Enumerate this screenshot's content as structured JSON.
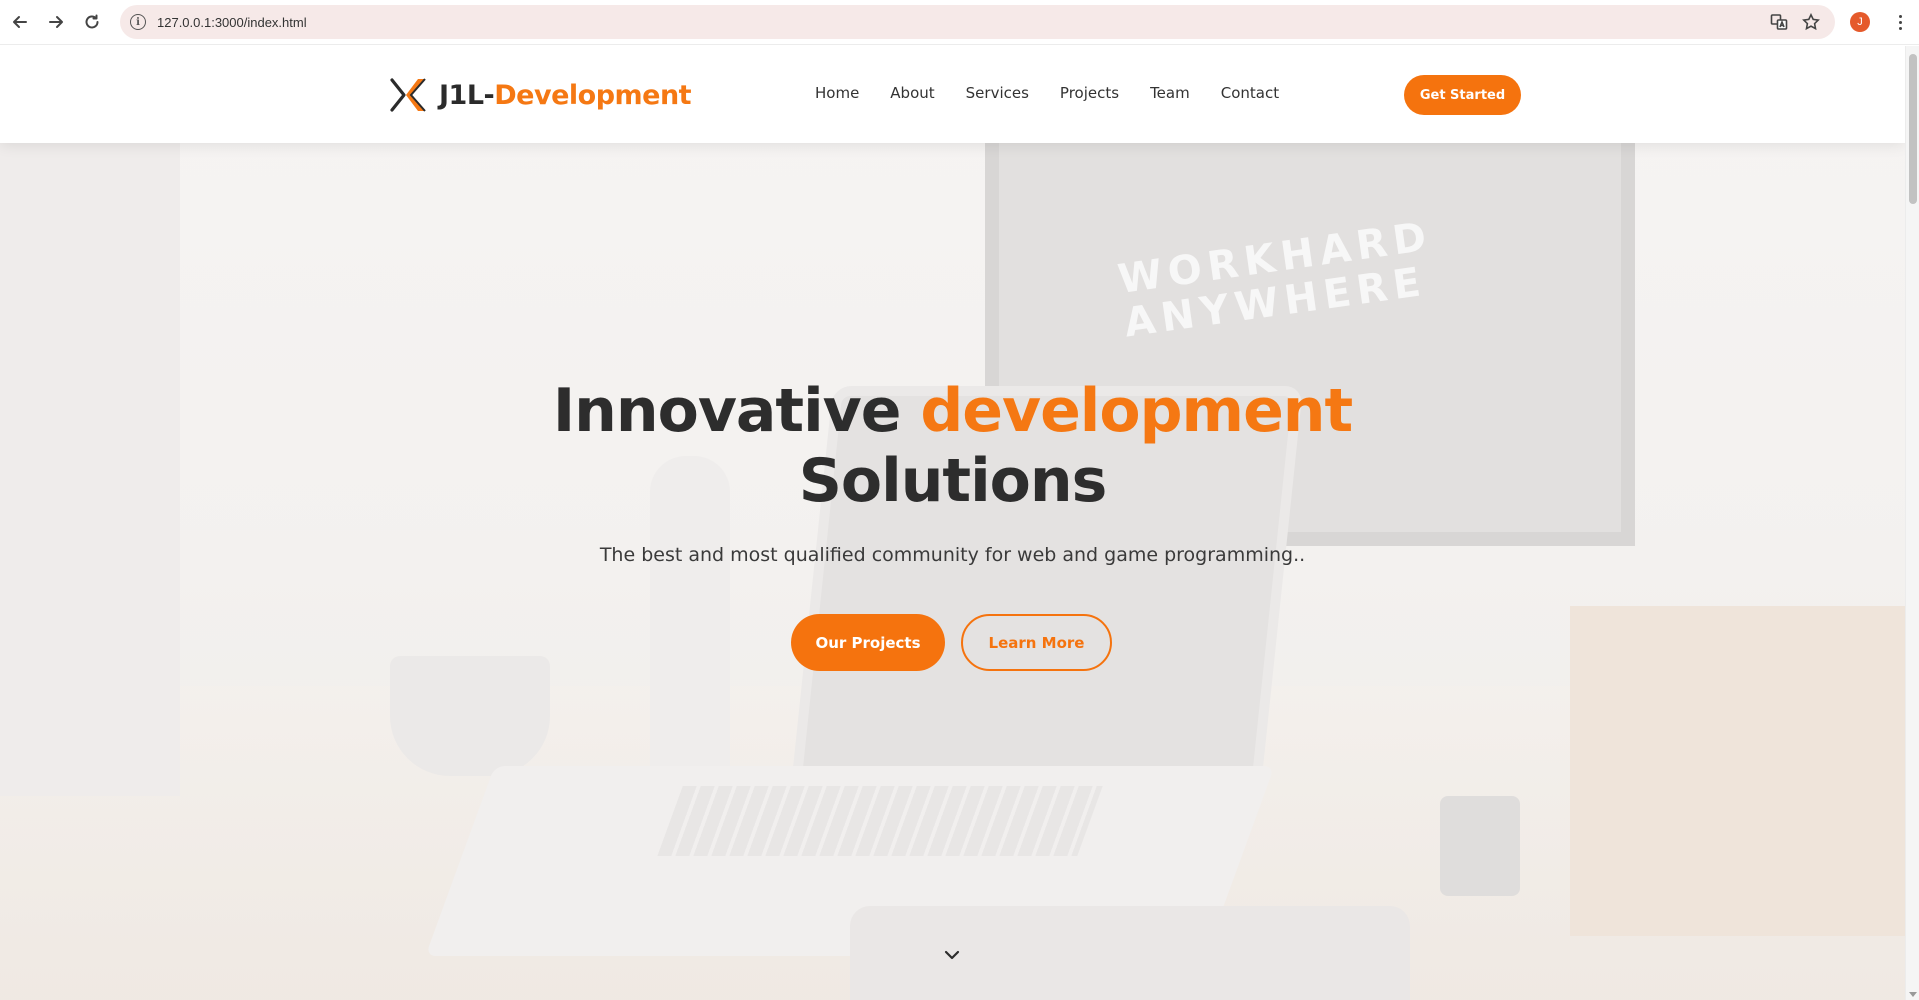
{
  "browser": {
    "url": "127.0.0.1:3000/index.html",
    "profile_initial": "J",
    "icons": {
      "back": "back-arrow-icon",
      "forward": "forward-arrow-icon",
      "reload": "reload-icon",
      "site_info": "info-icon",
      "translate": "translate-icon",
      "bookmark": "star-icon",
      "menu": "kebab-menu-icon"
    }
  },
  "header": {
    "logo_prefix": "J1L-",
    "logo_accent": "Development",
    "nav": [
      "Home",
      "About",
      "Services",
      "Projects",
      "Team",
      "Contact"
    ],
    "cta_label": "Get Started"
  },
  "hero": {
    "title_part1": "Innovative ",
    "title_accent": "development",
    "title_part2": "Solutions",
    "subtitle": "The best and most qualified community for web and game programming..",
    "primary_button": "Our Projects",
    "secondary_button": "Learn More",
    "background_text_line1": "WORKHARD",
    "background_text_line2": "ANYWHERE",
    "scroll_icon": "chevron-down-icon"
  },
  "colors": {
    "accent": "#f5730e",
    "text_dark": "#2d2d2d",
    "profile": "#e55a2b"
  }
}
